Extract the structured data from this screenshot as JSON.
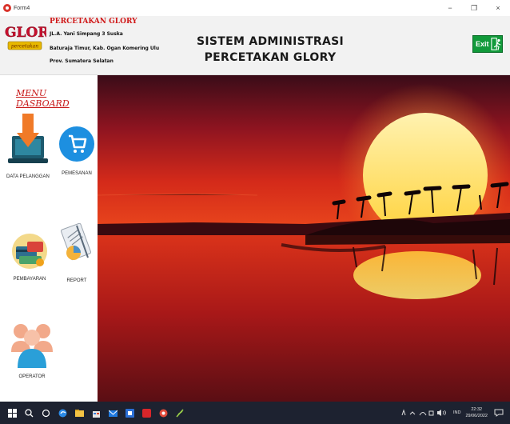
{
  "window": {
    "title": "Form4",
    "minimize_glyph": "−",
    "restore_glyph": "❐",
    "close_glyph": "×"
  },
  "header": {
    "logo_text": "GLORY",
    "logo_subtext": "percetakan",
    "company_name": "PERCETAKAN GLORY",
    "address_line1": "JL.A. Yani Simpang 3 Suska",
    "address_line2": "Baturaja Timur, Kab. Ogan Komering Ulu",
    "address_line3": "Prov. Sumatera Selatan",
    "system_title_line1": "SISTEM ADMINISTRASI",
    "system_title_line2": "PERCETAKAN GLORY",
    "exit_label": "Exit"
  },
  "sidebar": {
    "menu_title": "MENU DASBOARD",
    "items": [
      {
        "label": "DATA PELANGGAN",
        "icon": "laptop-download-icon"
      },
      {
        "label": "PEMESANAN",
        "icon": "shopping-cart-icon"
      },
      {
        "label": "PEMBAYARAN",
        "icon": "payment-icon"
      },
      {
        "label": "REPORT",
        "icon": "report-icon"
      },
      {
        "label": "OPERATOR",
        "icon": "users-icon"
      }
    ]
  },
  "taskbar": {
    "language": "IND",
    "time": "22:32",
    "date": "29/06/2022"
  },
  "colors": {
    "brand_red": "#d01818",
    "exit_green": "#119a3a",
    "taskbar_bg": "#1d2230"
  }
}
